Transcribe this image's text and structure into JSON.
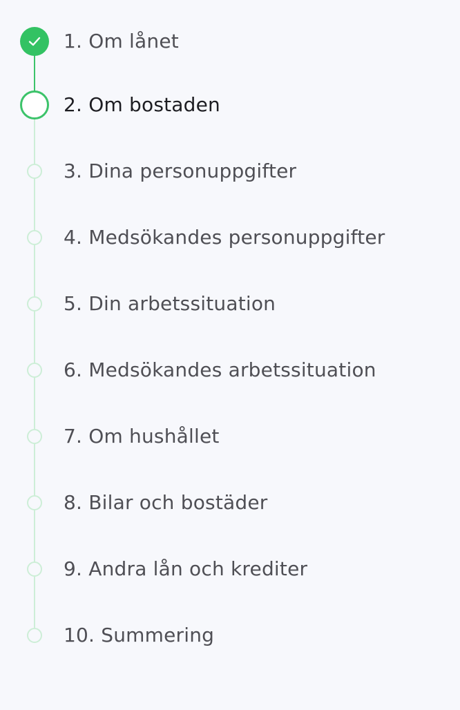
{
  "steps": [
    {
      "label": "1. Om lånet",
      "status": "completed"
    },
    {
      "label": "2. Om bostaden",
      "status": "current"
    },
    {
      "label": "3. Dina personuppgifter",
      "status": "upcoming"
    },
    {
      "label": "4. Medsökandes personuppgifter",
      "status": "upcoming"
    },
    {
      "label": "5. Din arbetssituation",
      "status": "upcoming"
    },
    {
      "label": "6. Medsökandes arbetssituation",
      "status": "upcoming"
    },
    {
      "label": "7. Om hushållet",
      "status": "upcoming"
    },
    {
      "label": "8. Bilar och bostäder",
      "status": "upcoming"
    },
    {
      "label": "9. Andra lån och krediter",
      "status": "upcoming"
    },
    {
      "label": "10. Summering",
      "status": "upcoming"
    }
  ],
  "colors": {
    "accent": "#33c263",
    "connector_done": "#3cc36a",
    "connector_todo": "#cdeed7",
    "background": "#f7f8fc",
    "text": "#4f4f55",
    "text_current": "#1d1d22"
  },
  "icons": {
    "completed": "check-icon"
  }
}
